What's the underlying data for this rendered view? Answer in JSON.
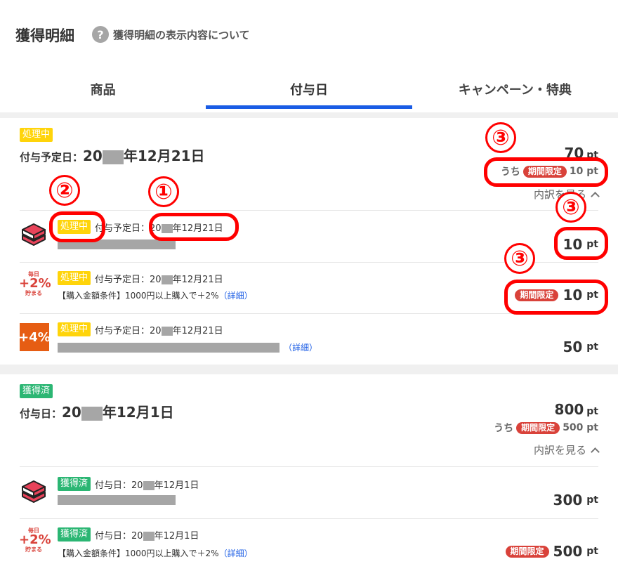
{
  "header": {
    "title": "獲得明細",
    "help_text": "獲得明細の表示内容について"
  },
  "tabs": [
    {
      "label": "商品"
    },
    {
      "label": "付与日"
    },
    {
      "label": "キャンペーン・特典"
    }
  ],
  "group1": {
    "status": "処理中",
    "date_label": "付与予定日：",
    "year_prefix": "20",
    "date_rest": "年12月21日",
    "total_value": "70",
    "unit": "pt",
    "uchi": "うち",
    "limited_label": "期間限定",
    "limited_value": "10 pt",
    "breakdown_label": "内訳を見る",
    "items": [
      {
        "status": "処理中",
        "date_text": "付与予定日：20",
        "date_rest": "年12月21日",
        "desc": "",
        "link": "",
        "points": "10",
        "limited": ""
      },
      {
        "status": "処理中",
        "date_text": "付与予定日：20",
        "date_rest": "年12月21日",
        "desc": "【購入金額条件】1000円以上購入で＋2%",
        "link": "（詳細）",
        "points": "10",
        "limited": "期間限定"
      },
      {
        "status": "処理中",
        "date_text": "付与予定日：20",
        "date_rest": "年12月21日",
        "desc": "",
        "link": "（詳細）",
        "points": "50",
        "limited": ""
      }
    ]
  },
  "group2": {
    "status": "獲得済",
    "date_label": "付与日：",
    "year_prefix": "20",
    "date_rest": "年12月1日",
    "total_value": "800",
    "unit": "pt",
    "uchi": "うち",
    "limited_label": "期間限定",
    "limited_value": "500 pt",
    "breakdown_label": "内訳を見る",
    "items": [
      {
        "status": "獲得済",
        "date_text": "付与日：20",
        "date_rest": "年12月1日",
        "desc": "",
        "link": "",
        "points": "300",
        "limited": ""
      },
      {
        "status": "獲得済",
        "date_text": "付与日：20",
        "date_rest": "年12月1日",
        "desc": "【購入金額条件】1000円以上購入で＋2%",
        "link": "（詳細）",
        "points": "500",
        "limited": "期間限定"
      }
    ]
  },
  "icons": {
    "plus2_top": "毎日",
    "plus2_mid": "+2%",
    "plus2_bot": "貯まる",
    "plus4": "+4%"
  },
  "annotations": {
    "one": "①",
    "two": "②",
    "three": "③"
  },
  "colors": {
    "accent": "#1a5ce5",
    "processing": "#ffd40a",
    "earned": "#2bb673",
    "limited": "#d9423a",
    "annotation": "#ff0000"
  }
}
